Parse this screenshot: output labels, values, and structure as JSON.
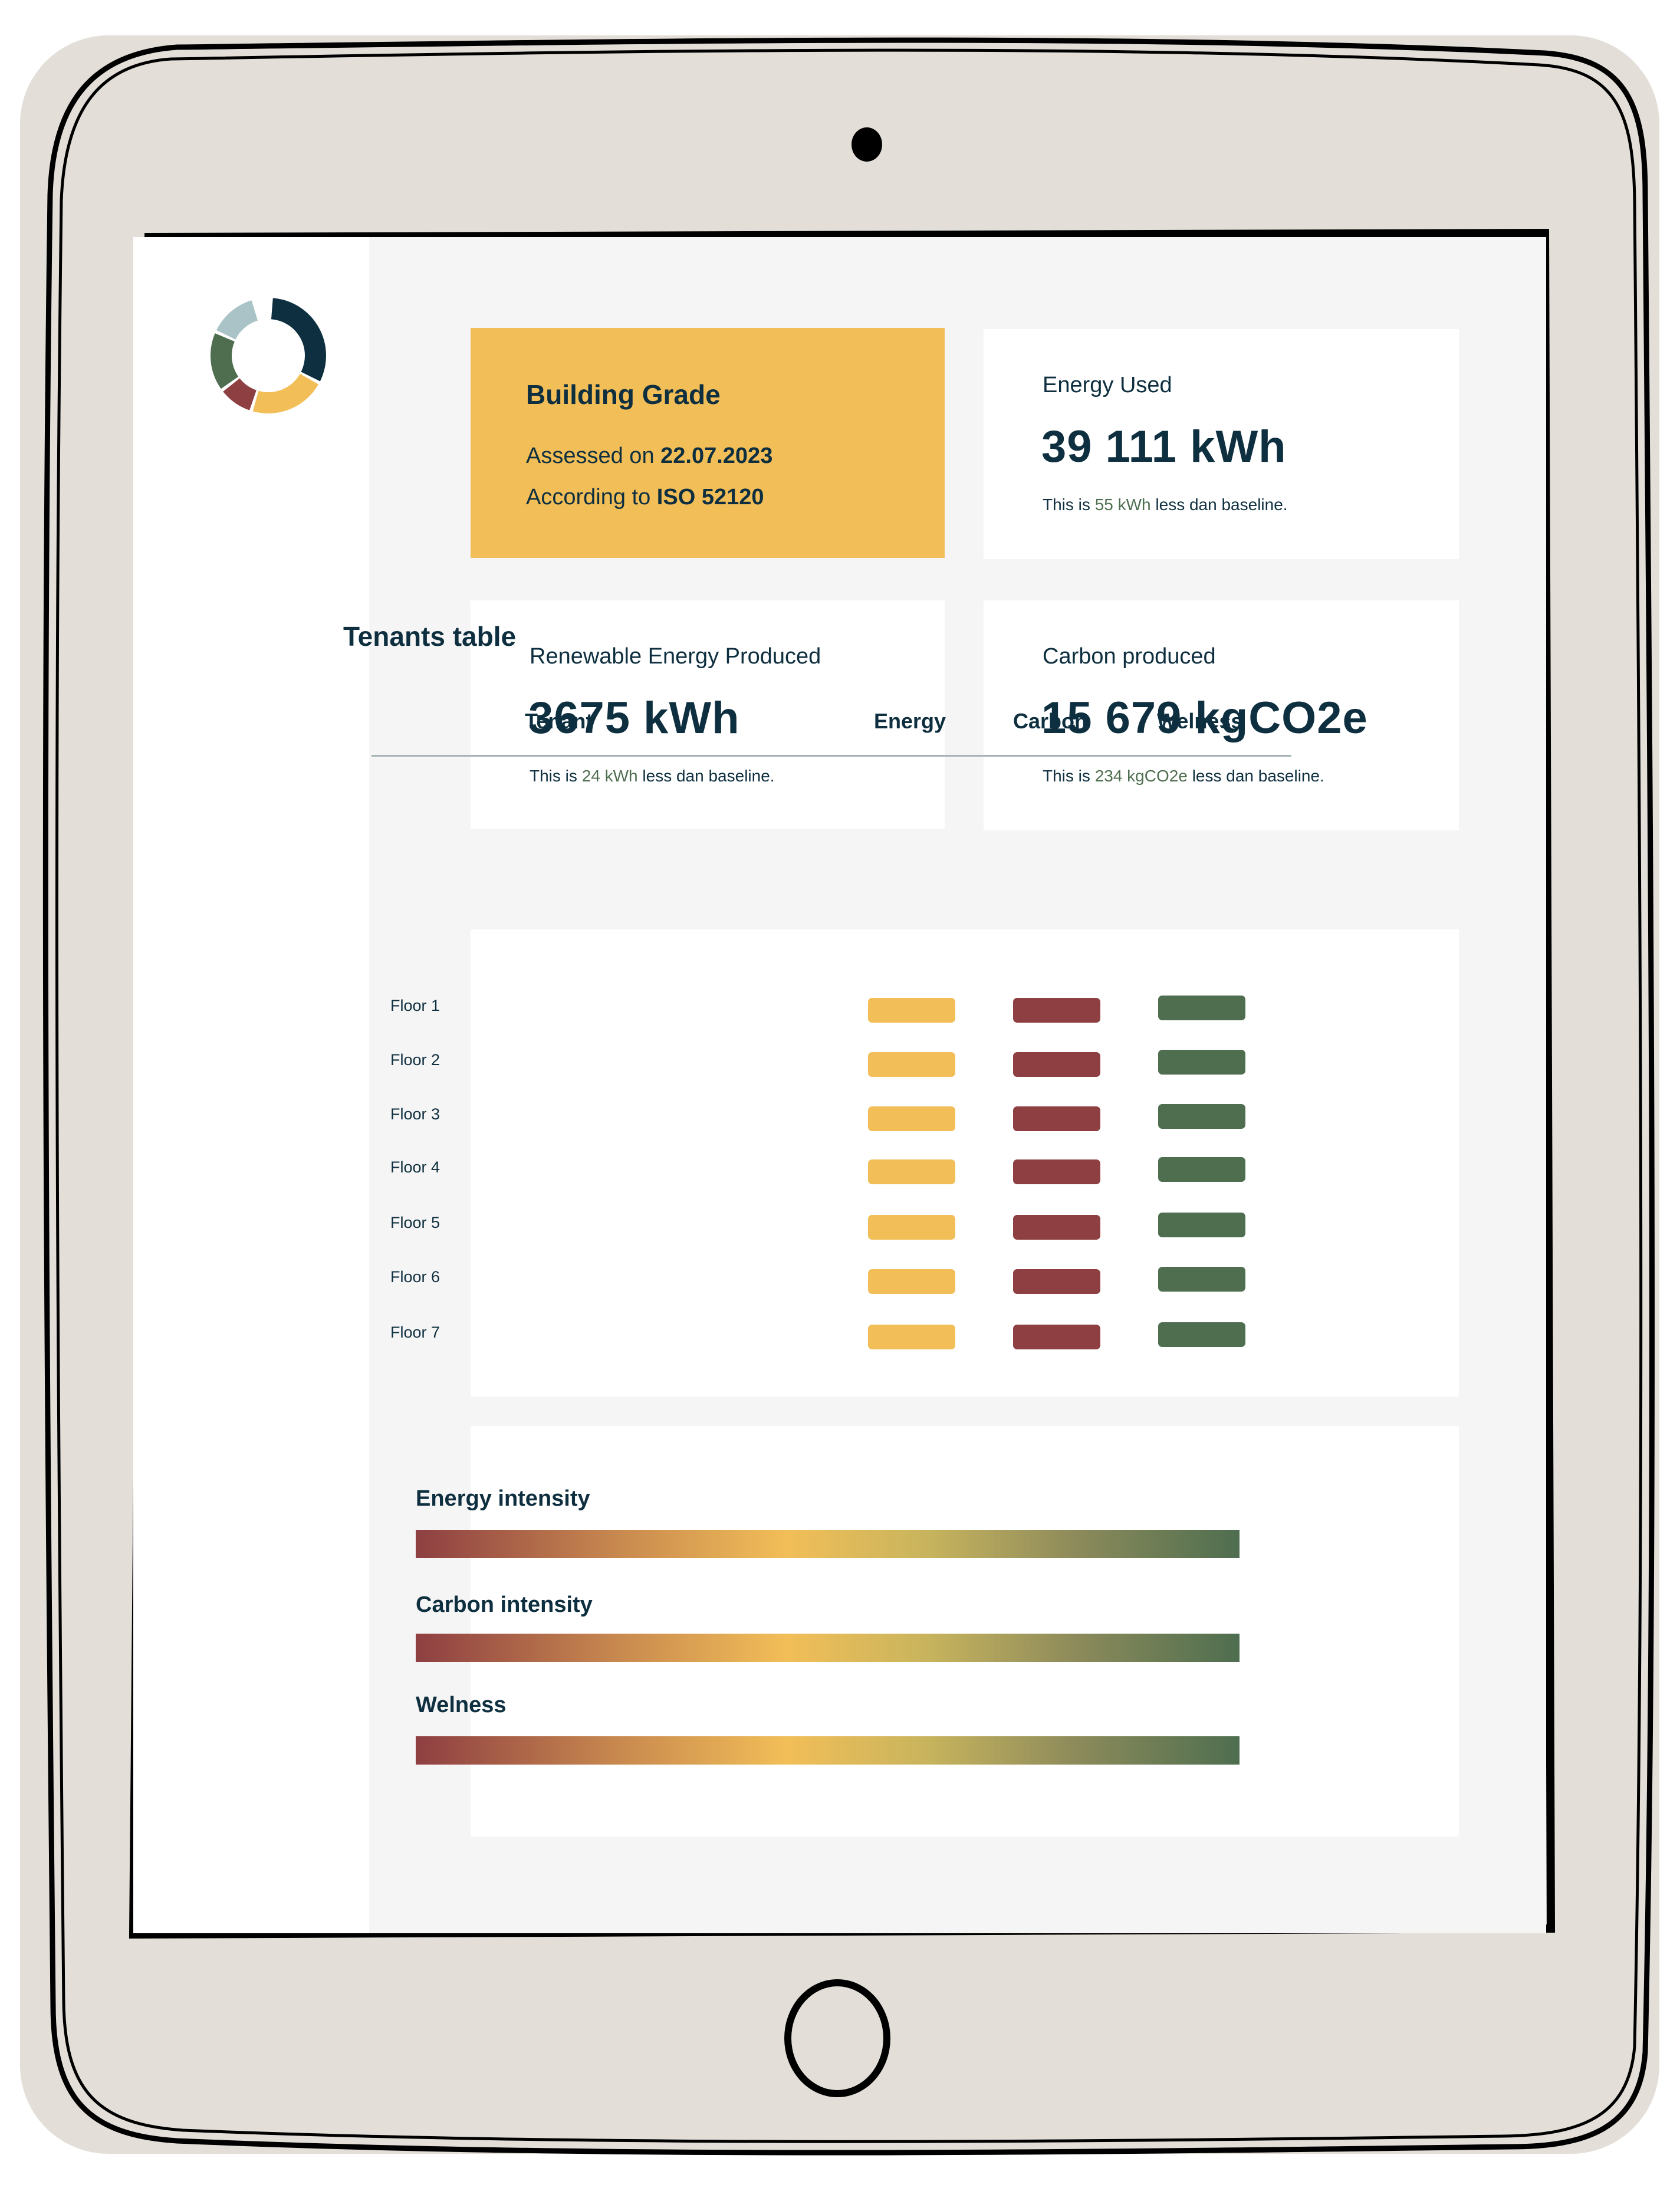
{
  "colors": {
    "tablet": "#e3dfd8",
    "navy": "#0e2f3f",
    "yellow": "#f2be58",
    "red": "#8e3f42",
    "green": "#4e6e4f",
    "lightblue": "#a9c3c7",
    "screen_bg": "#f6f5f5"
  },
  "logo": {
    "icon": "donut-logo-icon",
    "segments": [
      {
        "color": "#0e2f3f",
        "share": 0.32
      },
      {
        "color": "#f2be58",
        "share": 0.22
      },
      {
        "color": "#8e3f42",
        "share": 0.1
      },
      {
        "color": "#4e6e4f",
        "share": 0.17
      },
      {
        "color": "#a9c3c7",
        "share": 0.14
      }
    ]
  },
  "grade_card": {
    "title": "Building Grade",
    "assessed_prefix": "Assessed on",
    "assessed_date": "22.07.2023",
    "according_prefix": "According to",
    "standard": "ISO 52120"
  },
  "metrics": [
    {
      "label": "Energy Used",
      "value": "39 111 kWh",
      "note_prefix": "This is",
      "note_amount": "55 kWh",
      "note_suffix": "less dan baseline."
    },
    {
      "label": "Renewable Energy Produced",
      "value": "3675 kWh",
      "note_prefix": "This is",
      "note_amount": "24 kWh",
      "note_suffix": "less dan baseline."
    },
    {
      "label": "Carbon produced",
      "value": "15 679 kgCO2e",
      "note_prefix": "This is",
      "note_amount": "234 kgCO2e",
      "note_suffix": "less dan baseline."
    }
  ],
  "tenants": {
    "title": "Tenants table",
    "headers": [
      "Tenant",
      "Energy",
      "Carbon",
      "Welness"
    ],
    "rows": [
      "Floor 1",
      "Floor 2",
      "Floor 3",
      "Floor 4",
      "Floor 5",
      "Floor 6",
      "Floor 7"
    ],
    "status_colors": {
      "energy": "#f2be58",
      "carbon": "#8e3f42",
      "welness": "#4e6e4f"
    }
  },
  "intensity": {
    "items": [
      {
        "label": "Energy intensity"
      },
      {
        "label": "Carbon intensity"
      },
      {
        "label": "Welness"
      }
    ]
  }
}
